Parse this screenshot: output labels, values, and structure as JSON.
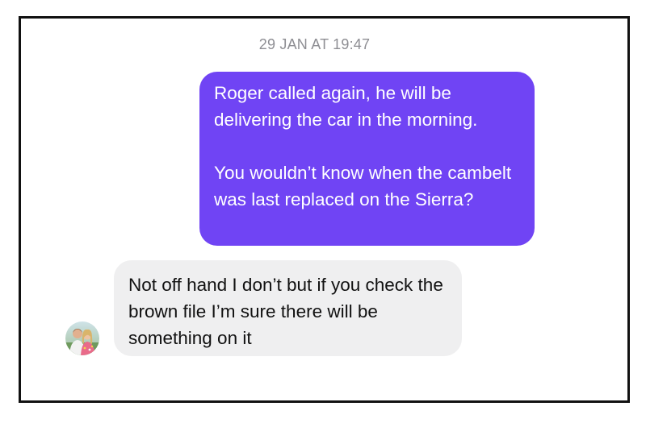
{
  "conversation": {
    "timestamp": "29 JAN AT 19:47",
    "outgoing": {
      "paragraph_1": "Roger called again, he will be delivering the car in the morning.",
      "paragraph_2": "You wouldn’t know when the cambelt was last replaced on the Sierra?"
    },
    "incoming": {
      "text": "Not off hand I don’t but if you check the brown file I’m sure there will be something on it"
    }
  },
  "colors": {
    "outgoing_bubble": "#7044f4",
    "incoming_bubble": "#efeff0",
    "timestamp_text": "#8e8e93",
    "frame_border": "#111111"
  },
  "icons": {
    "avatar": "contact-avatar-photo"
  }
}
